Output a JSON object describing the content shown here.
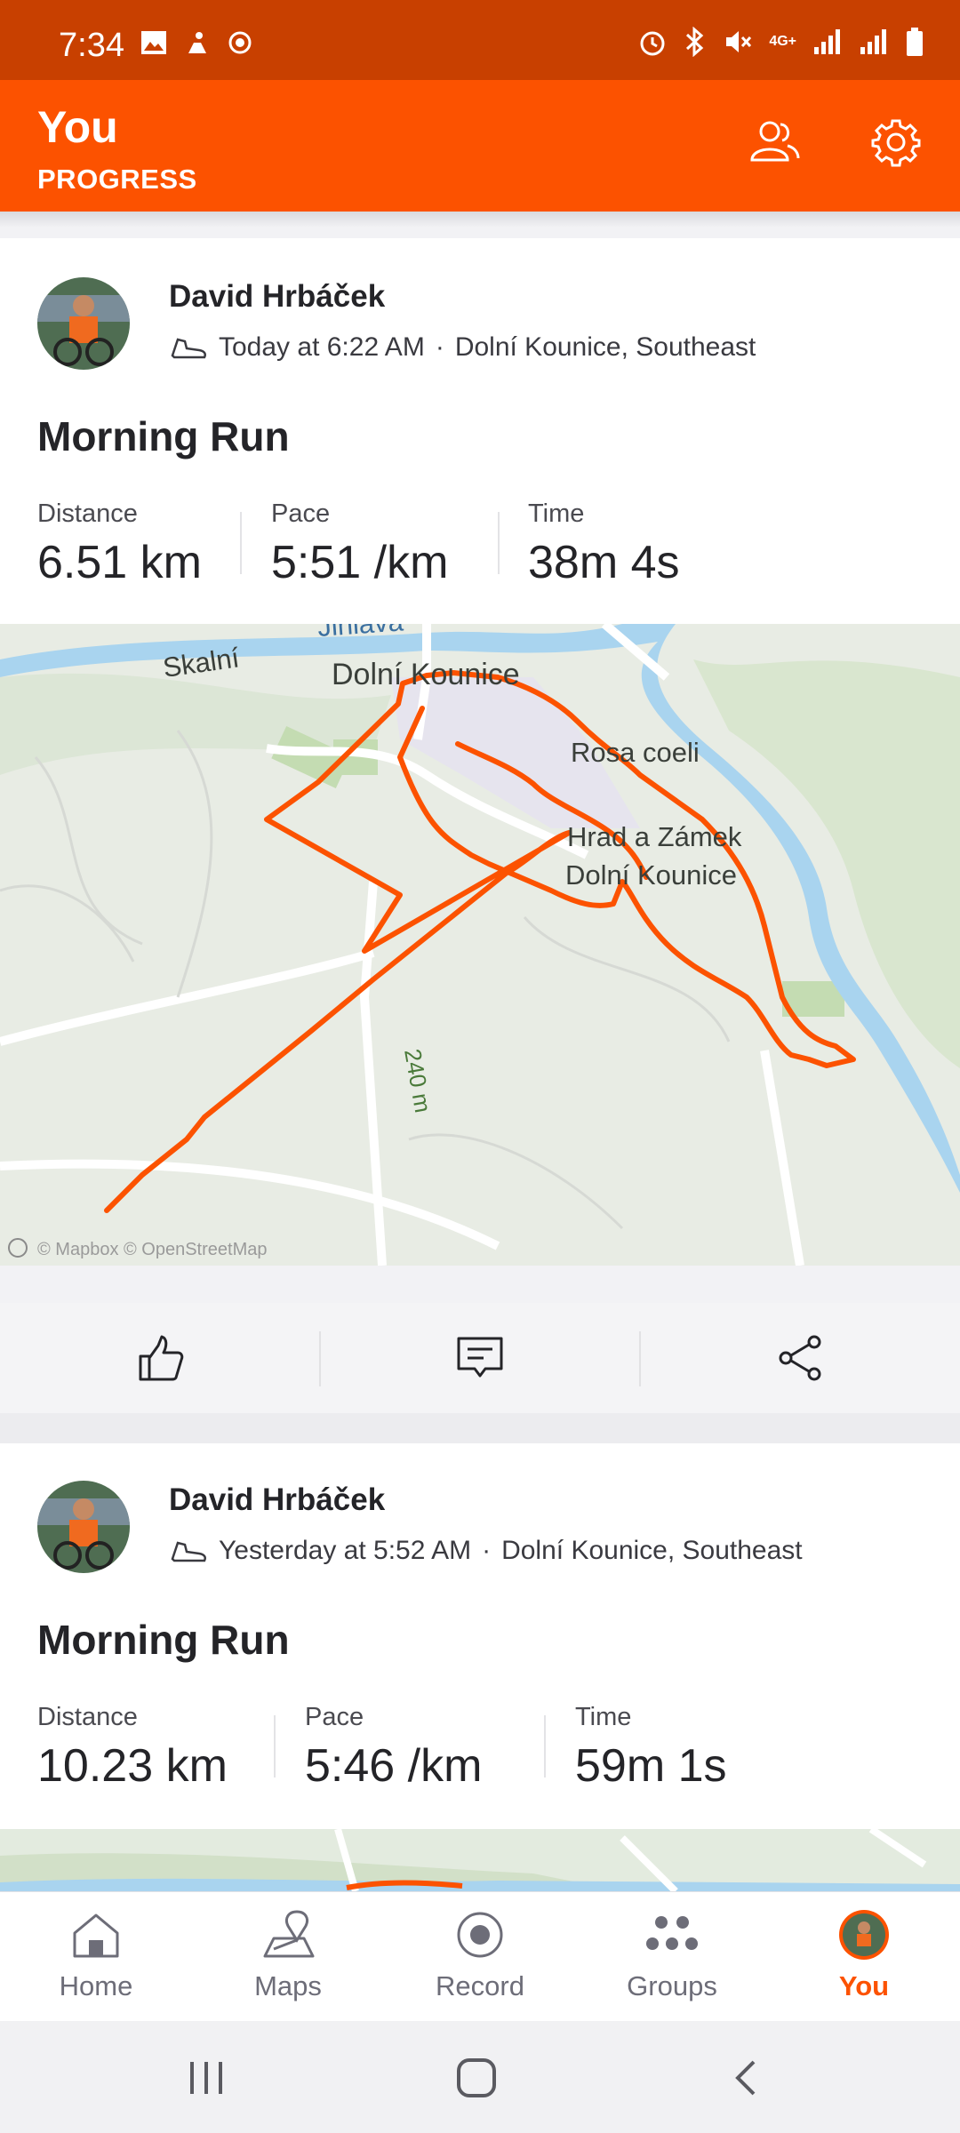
{
  "status_bar": {
    "time": "7:34",
    "network": "4G+"
  },
  "header": {
    "title": "You",
    "subtitle": "PROGRESS"
  },
  "colors": {
    "accent": "#fc5200",
    "route": "#fc5200",
    "status_bar": "#c84000"
  },
  "activities": [
    {
      "athlete": "David Hrbáček",
      "when": "Today at 6:22 AM",
      "location": "Dolní Kounice, Southeast",
      "title": "Morning Run",
      "stats": [
        {
          "label": "Distance",
          "value": "6.51 km"
        },
        {
          "label": "Pace",
          "value": "5:51 /km"
        },
        {
          "label": "Time",
          "value": "38m 4s"
        }
      ],
      "map": {
        "labels": [
          "Jihlava",
          "Skalní",
          "Dolní Kounice",
          "Rosa coeli",
          "Hrad a Zámek",
          "Dolní Kounice",
          "240 m"
        ],
        "attribution": "© Mapbox © OpenStreetMap"
      }
    },
    {
      "athlete": "David Hrbáček",
      "when": "Yesterday at 5:52 AM",
      "location": "Dolní Kounice, Southeast",
      "title": "Morning Run",
      "stats": [
        {
          "label": "Distance",
          "value": "10.23 km"
        },
        {
          "label": "Pace",
          "value": "5:46 /km"
        },
        {
          "label": "Time",
          "value": "59m 1s"
        }
      ]
    }
  ],
  "bottom_nav": [
    {
      "label": "Home",
      "icon": "home-icon"
    },
    {
      "label": "Maps",
      "icon": "maps-icon"
    },
    {
      "label": "Record",
      "icon": "record-icon"
    },
    {
      "label": "Groups",
      "icon": "groups-icon"
    },
    {
      "label": "You",
      "icon": "avatar",
      "active": true
    }
  ]
}
